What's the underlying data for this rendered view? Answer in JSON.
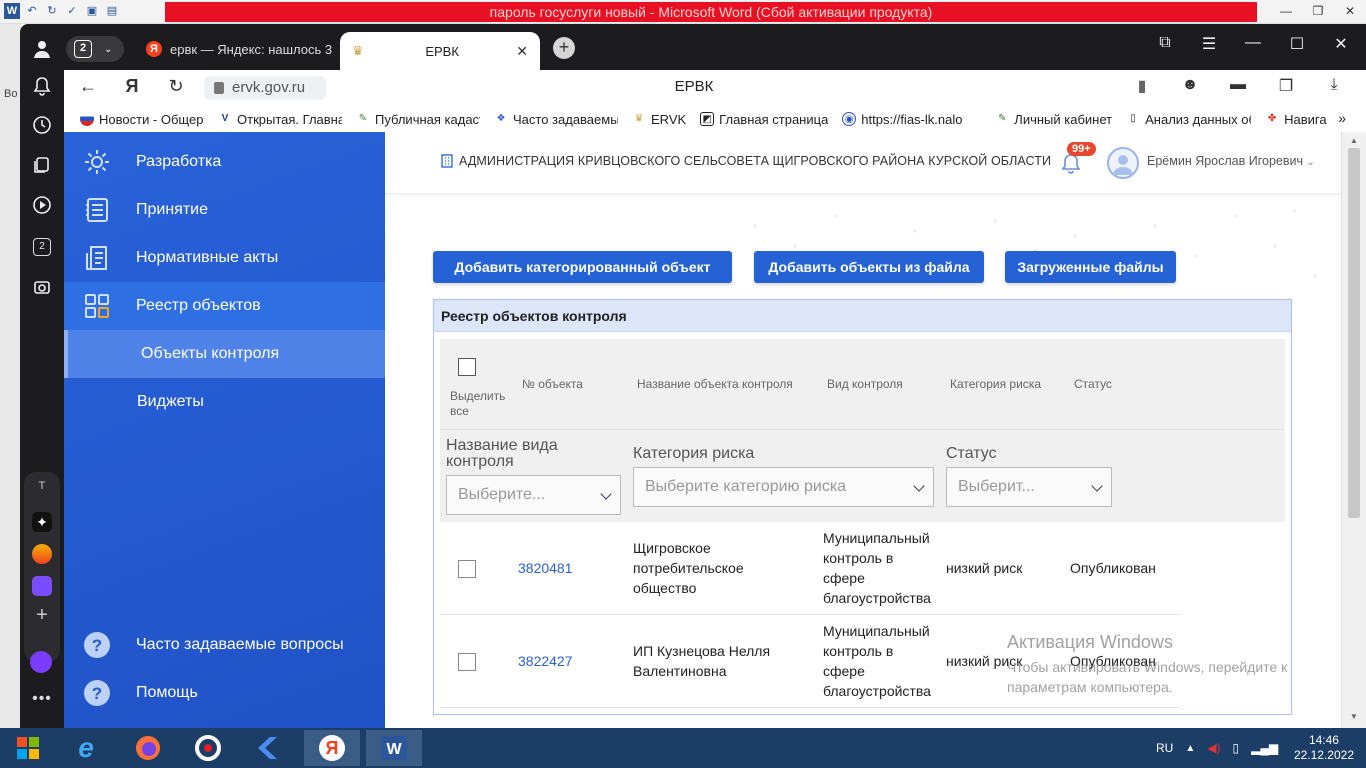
{
  "word": {
    "title": "пароль госуслуги новый - Microsoft Word (Сбой активации продукта)",
    "side_text": "Во"
  },
  "browser": {
    "tab_count": "2",
    "tabs": [
      {
        "label": "ервк — Яндекс: нашлось 3",
        "favicon": "Я"
      },
      {
        "label": "ЕРВК"
      }
    ],
    "url": "ervk.gov.ru",
    "page_title": "ЕРВК",
    "bookmarks": [
      "Новости - Общер",
      "Открытая. Главна",
      "Публичная кадаст",
      "Часто задаваемы",
      "ERVK",
      "Главная страница",
      "https://fias-lk.nalo",
      "Личный кабинет",
      "Анализ данных об",
      "Навига"
    ],
    "ya_side_badge": "2",
    "ya_side_letter": "T"
  },
  "sidebar": {
    "items": [
      {
        "label": "Разработка",
        "icon": "gear-icon"
      },
      {
        "label": "Принятие",
        "icon": "list-icon"
      },
      {
        "label": "Нормативные акты",
        "icon": "document-icon"
      },
      {
        "label": "Реестр объектов",
        "icon": "grid-icon"
      }
    ],
    "sub_item": "Объекты контроля",
    "widgets": "Виджеты",
    "faq": "Часто задаваемые вопросы",
    "help": "Помощь"
  },
  "header": {
    "org": "АДМИНИСТРАЦИЯ КРИВЦОВСКОГО СЕЛЬСОВЕТА ЩИГРОВСКОГО РАЙОНА КУРСКОЙ ОБЛАСТИ",
    "badge": "99+",
    "user": "Ерёмин Ярослав Игоревич"
  },
  "actions": {
    "add_categorized": "Добавить категорированный объект",
    "add_from_file": "Добавить объекты из файла",
    "uploaded_files": "Загруженные файлы"
  },
  "registry": {
    "title": "Реестр объектов контроля",
    "columns": {
      "select_all_1": "Выделить",
      "select_all_2": "все",
      "number": "№ объекта",
      "name": "Название объекта контроля",
      "kind": "Вид контроля",
      "risk": "Категория риска",
      "status": "Статус"
    },
    "filters": {
      "kind_label_1": "Название вида",
      "kind_label_2": "контроля",
      "kind_placeholder": "Выберите...",
      "risk_label": "Категория риска",
      "risk_placeholder": "Выберите категорию риска",
      "status_label": "Статус",
      "status_placeholder": "Выберит..."
    },
    "rows": [
      {
        "number": "3820481",
        "name": [
          "Щигровское",
          "потребительское",
          "общество"
        ],
        "kind": [
          "Муниципальный",
          "контроль в",
          "сфере",
          "благоустройства"
        ],
        "risk": "низкий риск",
        "status": "Опубликован"
      },
      {
        "number": "3822427",
        "name": [
          "ИП Кузнецова Нелля",
          "Валентиновна"
        ],
        "kind": [
          "Муниципальный",
          "контроль в",
          "сфере",
          "благоустройства"
        ],
        "risk": "низкий риск",
        "status": "Опубликован"
      }
    ]
  },
  "watermark": {
    "title": "Активация Windows",
    "line1": "Чтобы активировать Windows, перейдите к",
    "line2": "параметрам компьютера."
  },
  "taskbar": {
    "lang": "RU",
    "time": "14:46",
    "date": "22.12.2022"
  }
}
